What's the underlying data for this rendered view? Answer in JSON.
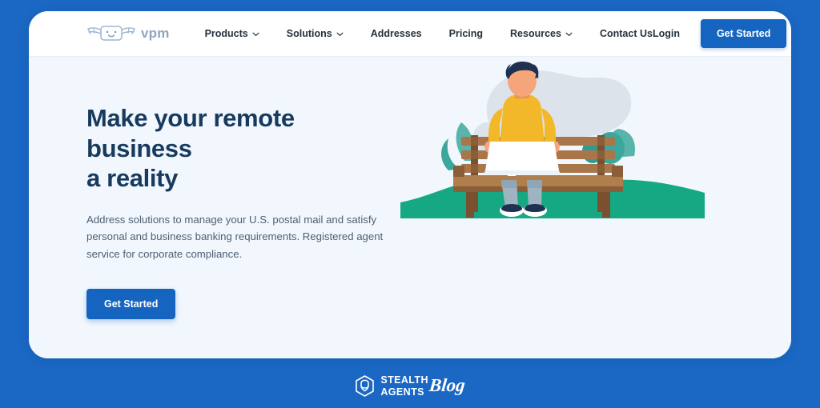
{
  "theme": {
    "frame_blue": "#1A68C4",
    "card_bg": "#F1F7FD",
    "nav_bg": "#FFFFFF",
    "accent_blue": "#1565C0",
    "heading_navy": "#173A5E",
    "body_grey": "#4E5F72",
    "grass_green": "#15A883",
    "plant_teal": "#3BA79A",
    "sweater_yellow": "#F2B829",
    "bench_brown": "#9C6B43",
    "hair_navy": "#1F3050",
    "skin": "#F6A479",
    "jeans": "#9FB4C2",
    "blob_grey": "#D9DFE8"
  },
  "navbar": {
    "logo": {
      "icon": "winged-envelope-icon",
      "text": "vpm"
    },
    "items": [
      {
        "label": "Products",
        "has_caret": true,
        "icon": "chevron-down-icon"
      },
      {
        "label": "Solutions",
        "has_caret": true,
        "icon": "chevron-down-icon"
      },
      {
        "label": "Addresses",
        "has_caret": false,
        "icon": ""
      },
      {
        "label": "Pricing",
        "has_caret": false,
        "icon": ""
      },
      {
        "label": "Resources",
        "has_caret": true,
        "icon": "chevron-down-icon"
      },
      {
        "label": "Contact Us",
        "has_caret": false,
        "icon": ""
      }
    ],
    "login_label": "Login",
    "cta_label": "Get Started"
  },
  "hero": {
    "title_line1": "Make your remote business",
    "title_line2": "a reality",
    "subtitle": "Address solutions to manage your U.S. postal mail and satisfy personal and business banking requirements. Registered agent service for corporate compliance.",
    "cta_label": "Get Started",
    "illustration": "person-on-bench-with-laptop-illustration"
  },
  "watermark": {
    "logo_icon": "stealth-agents-hexagon-icon",
    "line1": "STEALTH",
    "line2": "AGENTS",
    "script": "Blog"
  }
}
